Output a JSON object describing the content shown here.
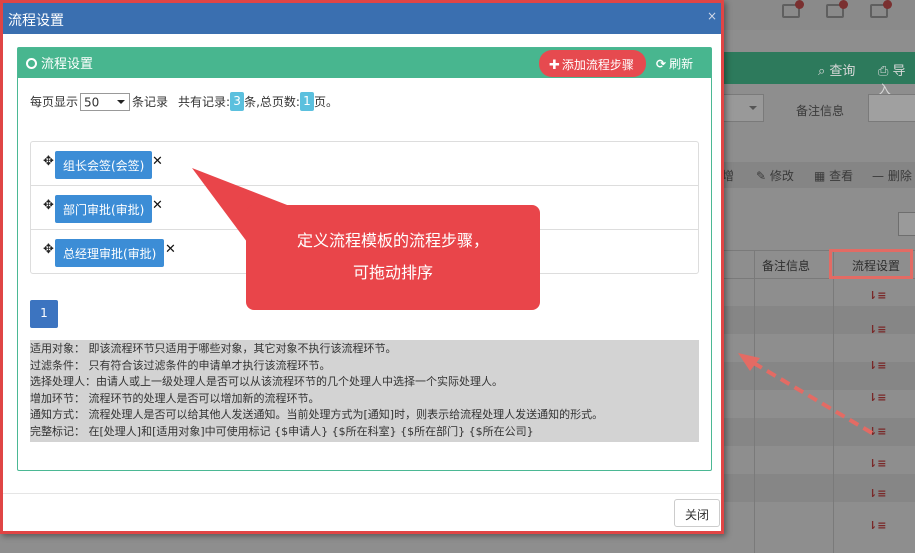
{
  "background": {
    "search_label": "查询",
    "import_label": "导入",
    "remark_label": "备注信息",
    "edit_label": "修改",
    "view_label": "查看",
    "delete_label": "删除",
    "add_partial_label": "增",
    "table_headers": [
      "备注信息",
      "流程设置"
    ]
  },
  "modal": {
    "title": "流程设置",
    "close_icon": "×",
    "panel_title": "流程设置",
    "add_step_label": "添加流程步骤",
    "refresh_label": "刷新",
    "toolbar": {
      "prefix": "每页显示",
      "page_size": "50",
      "suffix": "条记录",
      "total_prefix": "共有记录:",
      "total_count": "3",
      "total_suffix": "条,",
      "pages_prefix": "总页数:",
      "pages_count": "1",
      "pages_suffix": "页。"
    },
    "steps": [
      {
        "label": "组长会签(会签)"
      },
      {
        "label": "部门审批(审批)"
      },
      {
        "label": "总经理审批(审批)"
      }
    ],
    "current_page": "1",
    "help_lines": [
      "适用对象： 即该流程环节只适用于哪些对象，其它对象不执行该流程环节。",
      "过滤条件： 只有符合该过滤条件的申请单才执行该流程环节。",
      "选择处理人：由请人或上一级处理人是否可以从该流程环节的几个处理人中选择一个实际处理人。",
      "增加环节： 流程环节的处理人是否可以增加新的流程环节。",
      "通知方式： 流程处理人是否可以给其他人发送通知。当前处理方式为[通知]时，则表示给流程处理人发送通知的形式。",
      "完整标记： 在[处理人]和[适用对象]中可使用标记 {$申请人} {$所在科室} {$所在部门} {$所在公司}"
    ],
    "close_button": "关闭"
  },
  "callout": {
    "line1": "定义流程模板的流程步骤，",
    "line2": "可拖动排序"
  },
  "colors": {
    "title_bar": "#3a6fb0",
    "panel_green": "#48b68f",
    "add_button": "#e64a4f",
    "step_button": "#3c8dd6",
    "badge": "#5bc0de",
    "annotation_red": "#e9454a"
  }
}
